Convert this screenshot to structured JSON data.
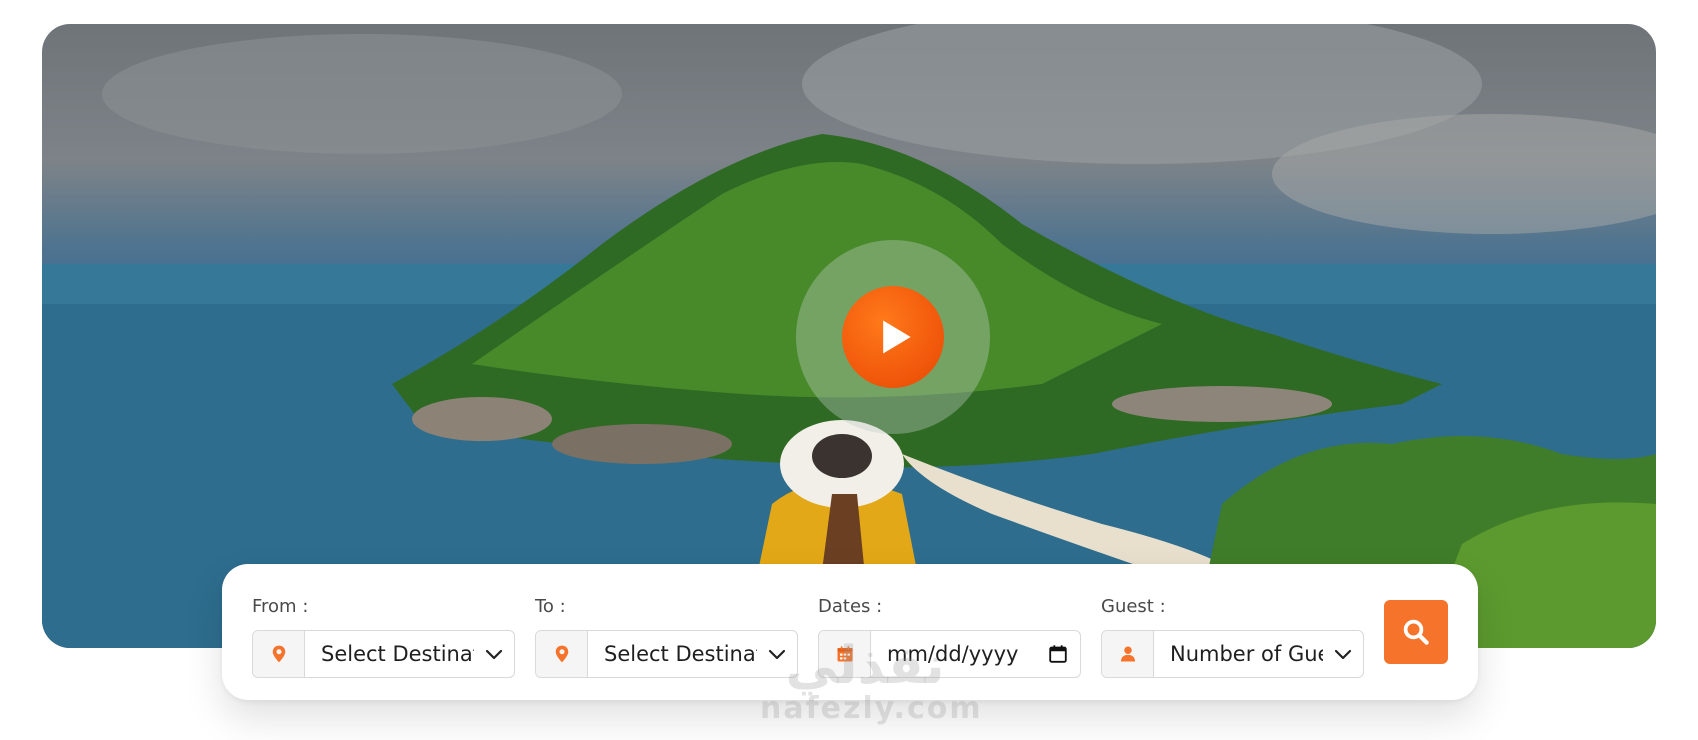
{
  "hero": {
    "image": "tropical-island-woman-in-sun-hat-icon",
    "play_icon": "play-icon"
  },
  "search": {
    "from": {
      "label": "From :",
      "value": "Select Destinat",
      "icon": "map-pin-icon"
    },
    "to": {
      "label": "To :",
      "value": "Select Destinat",
      "icon": "map-pin-icon"
    },
    "dates": {
      "label": "Dates :",
      "value": "mm/dd/yyyy",
      "icon": "calendar-icon"
    },
    "guest": {
      "label": "Guest :",
      "value": "Number of Gue",
      "icon": "user-icon"
    },
    "search_icon": "search-icon"
  },
  "colors": {
    "accent": "#f6732b",
    "play": "#f25a0c"
  },
  "watermark": {
    "arabic": "نفذلي",
    "latin": "nafezly.com"
  }
}
